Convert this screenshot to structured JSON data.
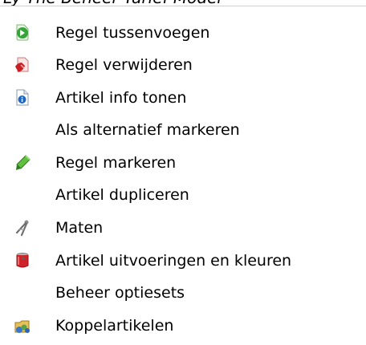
{
  "header_fragment": "Ly The Beheer Tarief Model",
  "menu": {
    "items": [
      {
        "label": "Regel tussenvoegen",
        "icon": "insert-row-icon"
      },
      {
        "label": "Regel verwijderen",
        "icon": "delete-row-icon"
      },
      {
        "label": "Artikel info tonen",
        "icon": "info-icon"
      },
      {
        "label": "Als alternatief markeren",
        "icon": ""
      },
      {
        "label": "Regel markeren",
        "icon": "marker-pen-icon"
      },
      {
        "label": "Artikel dupliceren",
        "icon": ""
      },
      {
        "label": "Maten",
        "icon": "compass-icon"
      },
      {
        "label": "Artikel uitvoeringen en kleuren",
        "icon": "paint-can-icon"
      },
      {
        "label": "Beheer optiesets",
        "icon": ""
      },
      {
        "label": "Koppelartikelen",
        "icon": "linked-items-icon"
      }
    ]
  }
}
